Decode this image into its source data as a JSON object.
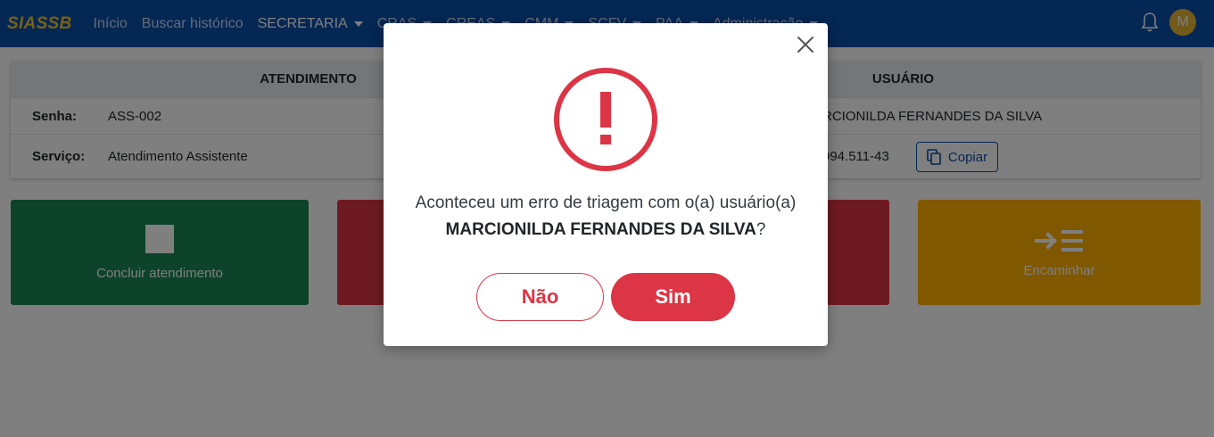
{
  "navbar": {
    "brand": "SIASSB",
    "items": [
      {
        "label": "Início",
        "dropdown": false
      },
      {
        "label": "Buscar histórico",
        "dropdown": false
      },
      {
        "label": "SECRETARIA",
        "dropdown": true
      },
      {
        "label": "CRAS",
        "dropdown": true
      },
      {
        "label": "CREAS",
        "dropdown": true
      },
      {
        "label": "CMM",
        "dropdown": true
      },
      {
        "label": "SCFV",
        "dropdown": true
      },
      {
        "label": "PAA",
        "dropdown": true
      },
      {
        "label": "Administração",
        "dropdown": true
      }
    ],
    "active_item": "SECRETARIA",
    "avatar_letter": "M",
    "bell_icon": "bell-icon"
  },
  "info": {
    "header_left": "ATENDIMENTO",
    "header_right": "USUÁRIO",
    "senha_label": "Senha:",
    "senha_value": "ASS-002",
    "servico_label": "Serviço:",
    "servico_value": "Atendimento Assistente",
    "user_name_partial": "RCIONILDA FERNANDES DA SILVA",
    "cpf_partial": "994.511-43",
    "copy_label": "Copiar"
  },
  "tiles": {
    "conclude_label": "Concluir atendimento",
    "forward_label": "Encaminhar"
  },
  "modal": {
    "message_line1": "Aconteceu um erro de triagem com o(a) usuário(a)",
    "user_name": "MARCIONILDA FERNANDES DA SILVA",
    "question_mark": "?",
    "no_label": "Não",
    "yes_label": "Sim"
  },
  "colors": {
    "navbar": "#0b4fa8",
    "brand": "#f2c230",
    "danger": "#dc3545",
    "success": "#198754",
    "warning": "#ffb000",
    "avatar": "#e3b534"
  }
}
